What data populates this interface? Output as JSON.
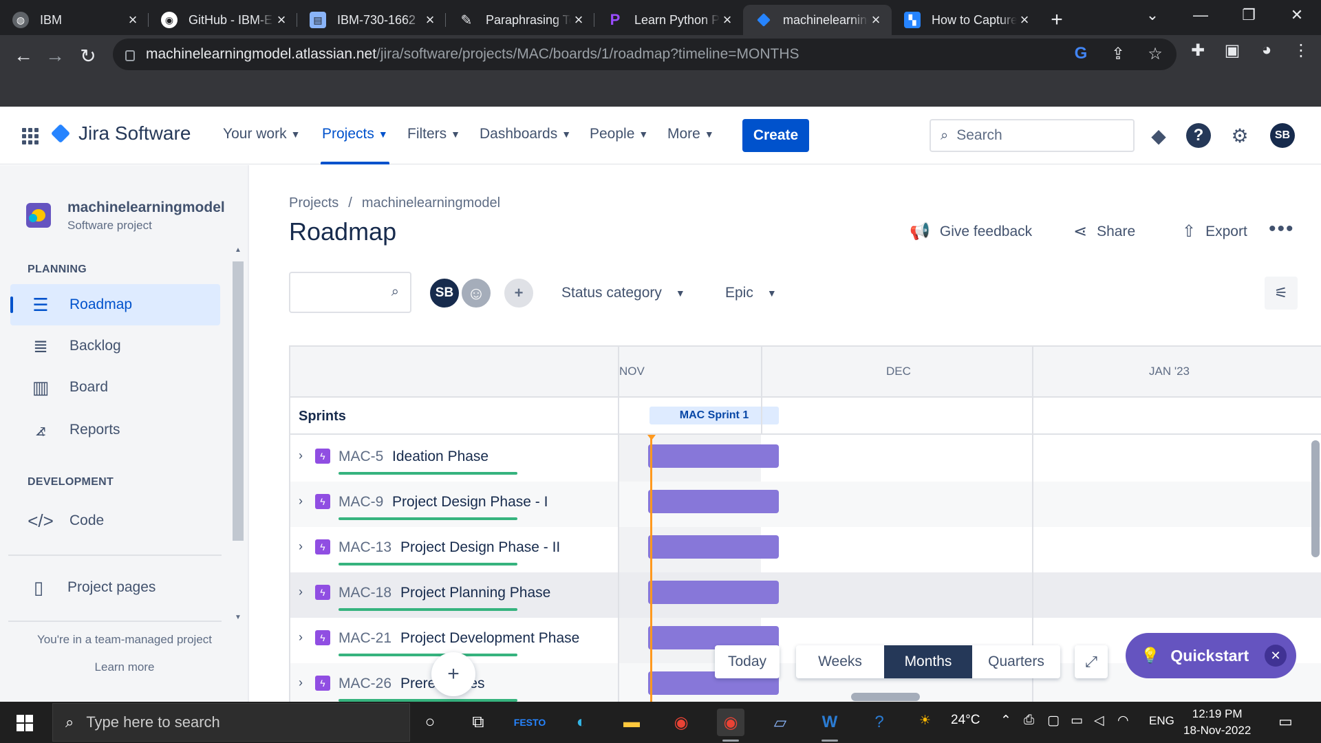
{
  "browser": {
    "tabs": [
      {
        "title": "IBM",
        "favicon": "globe-icon",
        "color": "#5f6368"
      },
      {
        "title": "GitHub - IBM-EPBL/IBM-Project",
        "favicon": "github-icon",
        "color": "#ffffff"
      },
      {
        "title": "IBM-730-1662",
        "favicon": "doc-icon",
        "color": "#8ab4f8"
      },
      {
        "title": "Paraphrasing Tool",
        "favicon": "quill-icon",
        "color": "#e8eaed"
      },
      {
        "title": "Learn Python Programming",
        "favicon": "p-icon",
        "color": "#7b2fbe"
      },
      {
        "title": "machinelearningmodel",
        "favicon": "jira-icon",
        "color": "#2684ff",
        "active": true
      },
      {
        "title": "How to Capture",
        "favicon": "snip-icon",
        "color": "#2684ff"
      }
    ],
    "url_host": "machinelearningmodel.atlassian.net",
    "url_path": "/jira/software/projects/MAC/boards/1/roadmap?timeline=MONTHS"
  },
  "nav": {
    "product": "Jira Software",
    "items": [
      {
        "label": "Your work"
      },
      {
        "label": "Projects",
        "active": true
      },
      {
        "label": "Filters"
      },
      {
        "label": "Dashboards"
      },
      {
        "label": "People"
      },
      {
        "label": "More"
      }
    ],
    "create_label": "Create",
    "search_placeholder": "Search",
    "user_initials": "SB"
  },
  "sidebar": {
    "project_name": "machinelearningmodel",
    "project_type": "Software project",
    "planning_heading": "PLANNING",
    "planning_items": [
      {
        "label": "Roadmap",
        "icon": "roadmap-icon",
        "active": true
      },
      {
        "label": "Backlog",
        "icon": "backlog-icon"
      },
      {
        "label": "Board",
        "icon": "board-icon"
      },
      {
        "label": "Reports",
        "icon": "reports-icon"
      }
    ],
    "development_heading": "DEVELOPMENT",
    "development_items": [
      {
        "label": "Code",
        "icon": "code-icon"
      }
    ],
    "project_pages": "Project pages",
    "team_note": "You're in a team-managed project",
    "learn_more": "Learn more"
  },
  "main": {
    "breadcrumb": [
      "Projects",
      "machinelearningmodel"
    ],
    "title": "Roadmap",
    "actions": {
      "feedback": "Give feedback",
      "share": "Share",
      "export": "Export"
    },
    "filters": {
      "avatar_initials": "SB",
      "status_category": "Status category",
      "epic": "Epic"
    },
    "timeline": {
      "months": [
        "NOV",
        "DEC",
        "JAN '23"
      ],
      "sprints_label": "Sprints",
      "sprint_name": "MAC Sprint 1",
      "epics": [
        {
          "key": "MAC-5",
          "summary": "Ideation Phase"
        },
        {
          "key": "MAC-9",
          "summary": "Project Design Phase - I"
        },
        {
          "key": "MAC-13",
          "summary": "Project Design Phase - II"
        },
        {
          "key": "MAC-18",
          "summary": "Project Planning Phase"
        },
        {
          "key": "MAC-21",
          "summary": "Project Development Phase"
        },
        {
          "key": "MAC-26",
          "summary": "Prerequisites"
        }
      ]
    },
    "controls": {
      "today": "Today",
      "zoom": [
        "Weeks",
        "Months",
        "Quarters"
      ],
      "zoom_selected": "Months",
      "quickstart": "Quickstart"
    }
  },
  "taskbar": {
    "search_placeholder": "Type here to search",
    "weather": "24°C",
    "language": "ENG",
    "time": "12:19 PM",
    "date": "18-Nov-2022"
  }
}
